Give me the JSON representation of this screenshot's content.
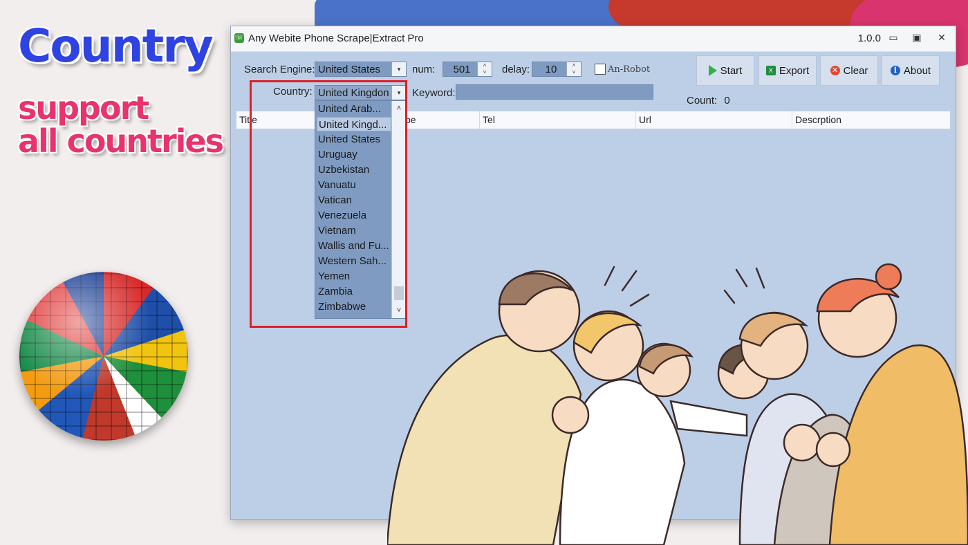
{
  "promo": {
    "title": "Country",
    "subtitle_line1": "support",
    "subtitle_line2": "all countries"
  },
  "window": {
    "title": "Any Webite Phone Scrape|Extract Pro",
    "version": "1.0.0",
    "controls": {
      "minimize": "▭",
      "maximize": "▣",
      "close": "✕"
    }
  },
  "form": {
    "search_engine_label": "Search Engine:",
    "search_engine_value": "United States",
    "num_label": "num:",
    "num_value": "501",
    "delay_label": "delay:",
    "delay_value": "10",
    "robot_label": "An-Robot",
    "country_label": "Country:",
    "country_value": "United Kingdon",
    "keyword_label": "Keyword:",
    "keyword_value": "",
    "count_label": "Count:",
    "count_value": "0"
  },
  "toolbar": {
    "start": "Start",
    "export": "Export",
    "clear": "Clear",
    "about": "About"
  },
  "table": {
    "columns": [
      "Title",
      "pe",
      "Tel",
      "Url",
      "Descrption"
    ]
  },
  "country_dropdown": {
    "items": [
      "United Arab...",
      "United Kingd...",
      "United States",
      "Uruguay",
      "Uzbekistan",
      "Vanuatu",
      "Vatican",
      "Venezuela",
      "Vietnam",
      "Wallis and Fu...",
      "Western Sah...",
      "Yemen",
      "Zambia",
      "Zimbabwe"
    ],
    "selected_index": 1
  },
  "colors": {
    "highlight_frame": "#e11d25",
    "window_bg": "#bdcfe7",
    "field_bg": "#7f9bc2",
    "promo_title": "#2f43e3",
    "promo_subtitle": "#e8336d"
  }
}
